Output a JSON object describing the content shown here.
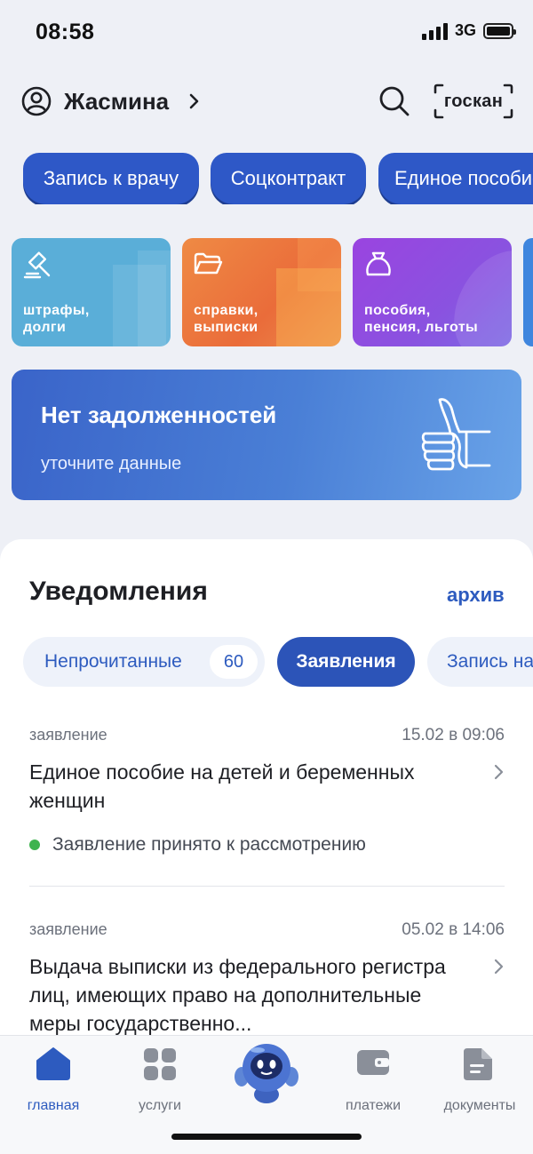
{
  "status_bar": {
    "time": "08:58",
    "network": "3G"
  },
  "profile": {
    "name": "Жасмина",
    "goskan_label": "госкан"
  },
  "chips": [
    "Запись к врачу",
    "Соцконтракт",
    "Единое пособие"
  ],
  "tiles": [
    {
      "label": "штрафы,\nдолги",
      "icon": "gavel-icon"
    },
    {
      "label": "справки,\nвыписки",
      "icon": "folder-icon"
    },
    {
      "label": "пособия,\nпенсия, льготы",
      "icon": "money-bag-icon"
    }
  ],
  "debt_banner": {
    "title": "Нет задолженностей",
    "subtitle": "уточните данные",
    "icon": "thumbs-up-icon"
  },
  "notifications": {
    "title": "Уведомления",
    "archive_label": "архив",
    "filters": {
      "unread_label": "Непрочитанные",
      "unread_count": "60",
      "applications_label": "Заявления",
      "record_label": "Запись на"
    },
    "items": [
      {
        "type": "заявление",
        "date": "15.02 в 09:06",
        "text": "Единое пособие на детей и беременных женщин",
        "status": "Заявление принято к рассмотрению",
        "status_color": "#3eb34f"
      },
      {
        "type": "заявление",
        "date": "05.02 в 14:06",
        "text": "Выдача выписки из федерального регистра лиц, имеющих право на дополнительные меры государственно..."
      }
    ]
  },
  "tab_bar": {
    "items": [
      {
        "label": "главная",
        "icon": "home-icon",
        "active": true
      },
      {
        "label": "услуги",
        "icon": "grid-icon",
        "active": false
      },
      {
        "label": "",
        "icon": "robot-assistant-icon",
        "active": false
      },
      {
        "label": "платежи",
        "icon": "wallet-icon",
        "active": false
      },
      {
        "label": "документы",
        "icon": "document-icon",
        "active": false
      }
    ]
  },
  "colors": {
    "primary": "#2e58c7",
    "accent_text": "#2d5bbf",
    "status_green": "#3eb34f"
  }
}
